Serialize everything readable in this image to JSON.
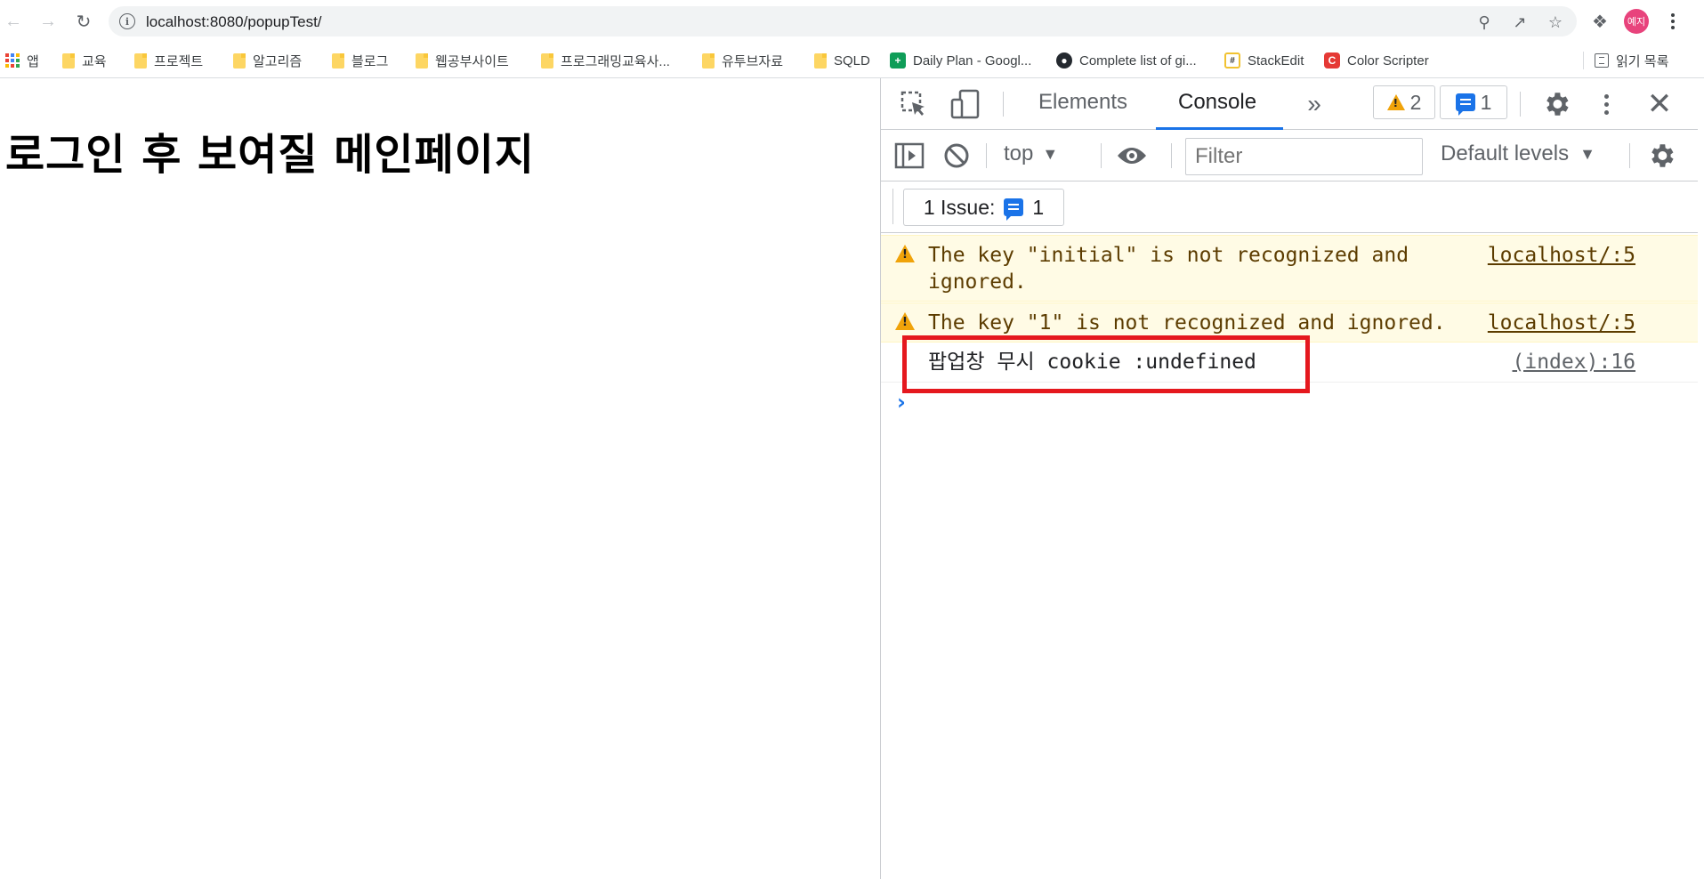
{
  "browser": {
    "url": "localhost:8080/popupTest/",
    "profile_initials": "예지",
    "bookmarks": [
      {
        "label": "앱",
        "icon": "apps-grid-icon"
      },
      {
        "label": "교육",
        "icon": "folder-icon"
      },
      {
        "label": "프로젝트",
        "icon": "folder-icon"
      },
      {
        "label": "알고리즘",
        "icon": "folder-icon"
      },
      {
        "label": "블로그",
        "icon": "folder-icon"
      },
      {
        "label": "웹공부사이트",
        "icon": "folder-icon"
      },
      {
        "label": "프로그래밍교육사...",
        "icon": "folder-icon"
      },
      {
        "label": "유투브자료",
        "icon": "folder-icon"
      },
      {
        "label": "SQLD",
        "icon": "folder-icon"
      },
      {
        "label": "Daily Plan - Googl...",
        "icon": "google-sheets-icon"
      },
      {
        "label": "Complete list of gi...",
        "icon": "github-icon"
      },
      {
        "label": "StackEdit",
        "icon": "stackedit-icon"
      },
      {
        "label": "Color Scripter",
        "icon": "color-scripter-icon"
      }
    ],
    "reading_list_label": "읽기 목록"
  },
  "page": {
    "heading": "로그인 후 보여질 메인페이지"
  },
  "devtools": {
    "tabs": [
      "Elements",
      "Console"
    ],
    "active_tab": "Console",
    "warning_count": "2",
    "message_count": "1",
    "context": "top",
    "filter_placeholder": "Filter",
    "levels": "Default levels",
    "issues_label": "1 Issue:",
    "issues_count": "1",
    "console_rows": [
      {
        "type": "warning",
        "message": "The key \"initial\" is not recognized and\nignored.",
        "source": "localhost/:5"
      },
      {
        "type": "warning",
        "message": "The key \"1\" is not recognized and ignored.",
        "source": "localhost/:5"
      },
      {
        "type": "log",
        "message": "팝업창 무시 cookie :undefined",
        "source": "(index):16"
      }
    ],
    "highlight_color": "#e5181e",
    "accent_color": "#1a73e8"
  }
}
